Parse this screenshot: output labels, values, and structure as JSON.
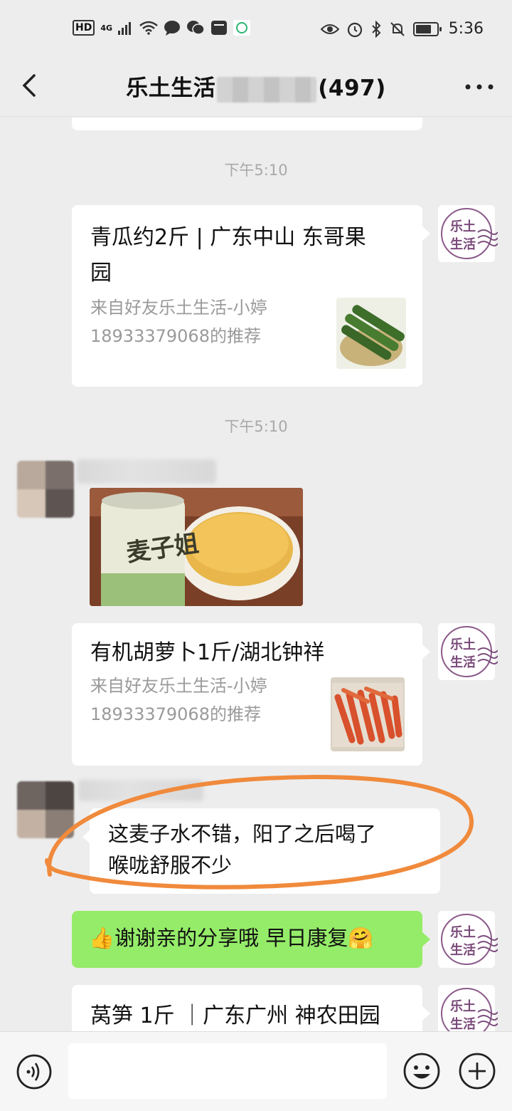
{
  "status_bar": {
    "left_badge": "HD",
    "network": "4G",
    "time": "5:36",
    "battery_level": 0.75
  },
  "nav": {
    "title_left": "乐土生活",
    "title_tail": "(497)",
    "back_icon": "chevron-left-icon",
    "more_icon": "more-dots-icon"
  },
  "avatar_text": {
    "line1": "乐土",
    "line2": "生活"
  },
  "messages": {
    "time1": "下午5:10",
    "card1": {
      "title_line1": "青瓜约2斤 | 广东中山 东哥果",
      "title_line2": "园",
      "sub_line1": "来自好友乐土生活-小婷",
      "sub_line2": "18933379068的推荐"
    },
    "time2": "下午5:10",
    "card2": {
      "title_line1": "有机胡萝卜1斤/湖北钟祥",
      "sub_line1": "来自好友乐土生活-小婷",
      "sub_line2": "18933379068的推荐"
    },
    "text1": {
      "line1": "这麦子水不错，阳了之后喝了",
      "line2": "喉咙舒服不少"
    },
    "reply": {
      "emoji_left": "👍",
      "text": "谢谢亲的分享哦 早日康复",
      "emoji_right": "🤗"
    },
    "card3": {
      "title_line1": "莴笋 1斤 ｜广东广州 神农田园"
    },
    "photo_text": "麦子姐"
  },
  "colors": {
    "background": "#ededed",
    "bubble_green": "#95ec69",
    "annotation_orange": "#f08a3c",
    "avatar_purple": "#7a4a7a"
  }
}
